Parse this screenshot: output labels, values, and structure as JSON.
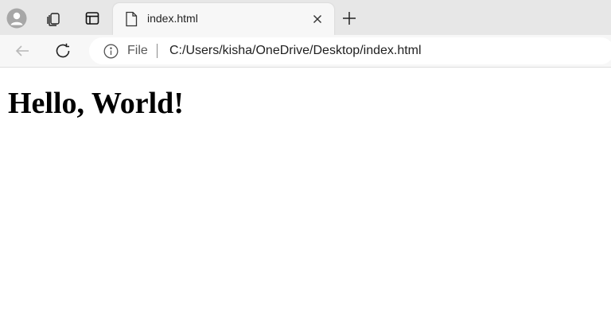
{
  "tab": {
    "title": "index.html",
    "file_icon": "page-icon",
    "close_icon": "close-icon"
  },
  "tabstrip": {
    "profile_icon": "profile-avatar-icon",
    "workspaces_icon": "workspaces-icon",
    "tab_actions_icon": "tab-actions-icon",
    "new_tab_icon": "plus-icon"
  },
  "toolbar": {
    "back_icon": "back-arrow-icon",
    "refresh_icon": "refresh-icon"
  },
  "address": {
    "info_icon": "info-icon",
    "scheme": "File",
    "url": "C:/Users/kisha/OneDrive/Desktop/index.html"
  },
  "page": {
    "heading": "Hello, World!"
  },
  "colors": {
    "tabstrip_bg": "#e7e7e7",
    "toolbar_bg": "#f7f7f7",
    "page_bg": "#ffffff",
    "text": "#000000"
  }
}
